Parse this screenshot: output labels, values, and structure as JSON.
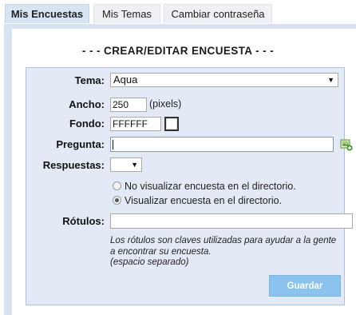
{
  "tabs": [
    {
      "label": "Mis Encuestas",
      "active": true
    },
    {
      "label": "Mis Temas",
      "active": false
    },
    {
      "label": "Cambiar contraseña",
      "active": false
    }
  ],
  "heading": "- - - CREAR/EDITAR ENCUESTA - - -",
  "form": {
    "tema_label": "Tema:",
    "tema_value": "Aqua",
    "ancho_label": "Ancho:",
    "ancho_value": "250",
    "ancho_unit": "(pixels)",
    "fondo_label": "Fondo:",
    "fondo_value": "FFFFFF",
    "fondo_color": "#FFFFFF",
    "pregunta_label": "Pregunta:",
    "pregunta_value": "",
    "respuestas_label": "Respuestas:",
    "respuestas_value": "",
    "radio_no_label": "No visualizar encuesta en el directorio.",
    "radio_yes_label": "Visualizar encuesta en el directorio.",
    "radio_selected": "yes",
    "rotulos_label": "Rótulos:",
    "rotulos_value": "",
    "hint_lines": [
      "Los rótulos son claves utilizadas para ayudar a la gente",
      "a encontrar su encuesta.",
      "(espacio separado)"
    ],
    "save_label": "Guardar"
  },
  "icons": {
    "add_question": "add-image-icon",
    "dropdown": "chevron-down-icon"
  },
  "colors": {
    "tab_active_bg": "#d8e4f3",
    "frame_bg": "#d7e3f2",
    "form_bg": "#e3eaf6",
    "button_bg": "#8ac3ee"
  }
}
